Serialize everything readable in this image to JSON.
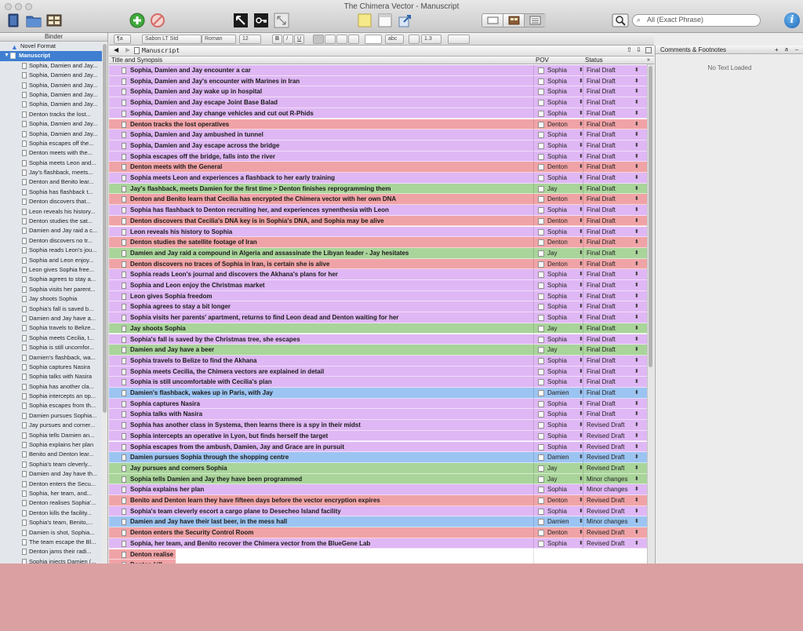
{
  "window": {
    "title": "The Chimera Vector - Manuscript"
  },
  "toolbar": {
    "search_placeholder": "All (Exact Phrase)"
  },
  "binder": {
    "header": "Binder",
    "novel_format": "Novel Format",
    "manuscript": "Manuscript",
    "items": [
      "Sophia, Damien and Jay...",
      "Sophia, Damien and Jay...",
      "Sophia, Damien and Jay...",
      "Sophia, Damien and Jay...",
      "Sophia, Damien and Jay...",
      "Denton tracks the lost...",
      "Sophia, Damien and Jay...",
      "Sophia, Damien and Jay...",
      "Sophia escapes off the...",
      "Denton meets with the...",
      "Sophia meets Leon and...",
      "Jay's flashback, meets...",
      "Denton and Benito lear...",
      "Sophia has flashback t...",
      "Denton discovers that...",
      "Leon reveals his history...",
      "Denton studies the sat...",
      "Damien and Jay raid a c...",
      "Denton discovers no tr...",
      "Sophia reads Leon's jou...",
      "Sophia and Leon enjoy...",
      "Leon gives Sophia free...",
      "Sophia agrees to stay a...",
      "Sophia visits her parent...",
      "Jay shoots Sophia",
      "Sophia's fall is saved b...",
      "Damien and Jay have a...",
      "Sophia travels to Belize...",
      "Sophia meets Cecilia, t...",
      "Sophia is still uncomfor...",
      "Damien's flashback, wa...",
      "Sophia captures Nasira",
      "Sophia talks with Nasira",
      "Sophia has another cla...",
      "Sophia intercepts an op...",
      "Sophia escapes from th...",
      "Damien pursues Sophia...",
      "Jay pursues and corner...",
      "Sophia tells Damien an...",
      "Sophia explains her plan",
      "Benito and Denton lear...",
      "Sophia's team cleverly...",
      "Damien and Jay have th...",
      "Denton enters the Secu...",
      "Sophia, her team, and...",
      "Denton realises Sophia'...",
      "Denton kills the facility...",
      "Sophia's team, Benito,...",
      "Damien is shot, Sophia...",
      "The team escape the Bl...",
      "Denton jams their radi...",
      "Sophia injects Damien (..."
    ]
  },
  "format_bar": {
    "style": "¶a",
    "font": "Sabon LT Std",
    "typeface": "Roman",
    "size": "12",
    "bold": "B",
    "italic": "I",
    "underline": "U",
    "spacing": "1.3",
    "abc": "abc"
  },
  "editor": {
    "doc_title": "Manuscript",
    "columns": {
      "title": "Title and Synopsis",
      "pov": "POV",
      "status": "Status"
    }
  },
  "colors": {
    "sophia": "#dfb7f4",
    "denton": "#f0a3a6",
    "jay": "#a9d49a",
    "damien": "#9cc4f2"
  },
  "rows": [
    {
      "title": "Sophia, Damien and Jay encounter a car",
      "pov": "Sophia",
      "status": "Final Draft"
    },
    {
      "title": "Sophia, Damien and Jay's encounter with Marines in Iran",
      "pov": "Sophia",
      "status": "Final Draft"
    },
    {
      "title": "Sophia, Damien and Jay wake up in hospital",
      "pov": "Sophia",
      "status": "Final Draft"
    },
    {
      "title": "Sophia, Damien and Jay escape Joint Base Balad",
      "pov": "Sophia",
      "status": "Final Draft"
    },
    {
      "title": "Sophia, Damien and Jay change vehicles and cut out R-Phids",
      "pov": "Sophia",
      "status": "Final Draft"
    },
    {
      "title": "Denton tracks the lost operatives",
      "pov": "Denton",
      "status": "Final Draft"
    },
    {
      "title": "Sophia, Damien and Jay ambushed in tunnel",
      "pov": "Sophia",
      "status": "Final Draft"
    },
    {
      "title": "Sophia, Damien and Jay escape across the bridge",
      "pov": "Sophia",
      "status": "Final Draft"
    },
    {
      "title": "Sophia escapes off the bridge, falls into the river",
      "pov": "Sophia",
      "status": "Final Draft"
    },
    {
      "title": "Denton meets with the General",
      "pov": "Denton",
      "status": "Final Draft"
    },
    {
      "title": "Sophia meets Leon and experiences a flashback to her early training",
      "pov": "Sophia",
      "status": "Final Draft"
    },
    {
      "title": "Jay's flashback, meets Damien for the first time > Denton finishes reprogramming them",
      "pov": "Jay",
      "status": "Final Draft"
    },
    {
      "title": "Denton and Benito learn that Cecilia has encrypted the Chimera vector with her own DNA",
      "pov": "Denton",
      "status": "Final Draft"
    },
    {
      "title": "Sophia has flashback to Denton recruiting her, and experiences synenthesia with Leon",
      "pov": "Sophia",
      "status": "Final Draft"
    },
    {
      "title": "Denton discovers that Cecilia's DNA key is in Sophia's DNA, and Sophia may be alive",
      "pov": "Denton",
      "status": "Final Draft"
    },
    {
      "title": "Leon reveals his history to Sophia",
      "pov": "Sophia",
      "status": "Final Draft"
    },
    {
      "title": "Denton studies the satellite footage of Iran",
      "pov": "Denton",
      "status": "Final Draft"
    },
    {
      "title": "Damien and Jay raid a compound in Algeria and assassinate the Libyan leader - Jay hesitates",
      "pov": "Jay",
      "status": "Final Draft"
    },
    {
      "title": "Denton discovers no traces of Sophia in Iran, is certain she is alive",
      "pov": "Denton",
      "status": "Final Draft"
    },
    {
      "title": "Sophia reads Leon's journal and discovers the Akhana's plans for her",
      "pov": "Sophia",
      "status": "Final Draft"
    },
    {
      "title": "Sophia and Leon enjoy the Christmas market",
      "pov": "Sophia",
      "status": "Final Draft"
    },
    {
      "title": "Leon gives Sophia freedom",
      "pov": "Sophia",
      "status": "Final Draft"
    },
    {
      "title": "Sophia agrees to stay a bit longer",
      "pov": "Sophia",
      "status": "Final Draft"
    },
    {
      "title": "Sophia visits her parents' apartment, returns to find Leon dead and Denton waiting for her",
      "pov": "Sophia",
      "status": "Final Draft"
    },
    {
      "title": "Jay shoots Sophia",
      "pov": "Jay",
      "status": "Final Draft"
    },
    {
      "title": "Sophia's fall is saved by the Christmas tree, she escapes",
      "pov": "Sophia",
      "status": "Final Draft"
    },
    {
      "title": "Damien and Jay have a beer",
      "pov": "Jay",
      "status": "Final Draft"
    },
    {
      "title": "Sophia travels to Belize to find the Akhana",
      "pov": "Sophia",
      "status": "Final Draft"
    },
    {
      "title": "Sophia meets Cecilia, the Chimera vectors are explained in detail",
      "pov": "Sophia",
      "status": "Final Draft"
    },
    {
      "title": "Sophia is still uncomfortable with Cecilia's plan",
      "pov": "Sophia",
      "status": "Final Draft"
    },
    {
      "title": "Damien's flashback, wakes up in Paris, with Jay",
      "pov": "Damien",
      "status": "Final Draft"
    },
    {
      "title": "Sophia captures Nasira",
      "pov": "Sophia",
      "status": "Final Draft"
    },
    {
      "title": "Sophia talks with Nasira",
      "pov": "Sophia",
      "status": "Final Draft"
    },
    {
      "title": "Sophia has another class in Systema, then learns there is a spy in their midst",
      "pov": "Sophia",
      "status": "Revised Draft"
    },
    {
      "title": "Sophia intercepts an operative in Lyon, but finds herself the target",
      "pov": "Sophia",
      "status": "Revised Draft"
    },
    {
      "title": "Sophia escapes from the ambush, Damien, Jay and Grace are in pursuit",
      "pov": "Sophia",
      "status": "Revised Draft"
    },
    {
      "title": "Damien pursues Sophia through the shopping centre",
      "pov": "Damien",
      "status": "Revised Draft"
    },
    {
      "title": "Jay pursues and corners Sophia",
      "pov": "Jay",
      "status": "Revised Draft"
    },
    {
      "title": "Sophia tells Damien and Jay they have been programmed",
      "pov": "Jay",
      "status": "Minor changes"
    },
    {
      "title": "Sophia explains her plan",
      "pov": "Sophia",
      "status": "Minor changes"
    },
    {
      "title": "Benito and Denton learn they have fifteen days before the vector encryption expires",
      "pov": "Denton",
      "status": "Revised Draft"
    },
    {
      "title": "Sophia's team cleverly escort a cargo plane to Desecheo Island facility",
      "pov": "Sophia",
      "status": "Revised Draft"
    },
    {
      "title": "Damien and Jay have their last beer, in the mess hall",
      "pov": "Damien",
      "status": "Minor changes"
    },
    {
      "title": "Denton enters the Security Control Room",
      "pov": "Denton",
      "status": "Revised Draft"
    },
    {
      "title": "Sophia, her team, and Benito recover the Chimera vector from the BlueGene Lab",
      "pov": "Sophia",
      "status": "Revised Draft"
    },
    {
      "title": "Denton realise",
      "pov": "",
      "status": ""
    },
    {
      "title": "Denton kill",
      "pov": "",
      "status": ""
    }
  ],
  "inspector": {
    "header": "Comments & Footnotes",
    "empty_text": "No Text Loaded"
  }
}
